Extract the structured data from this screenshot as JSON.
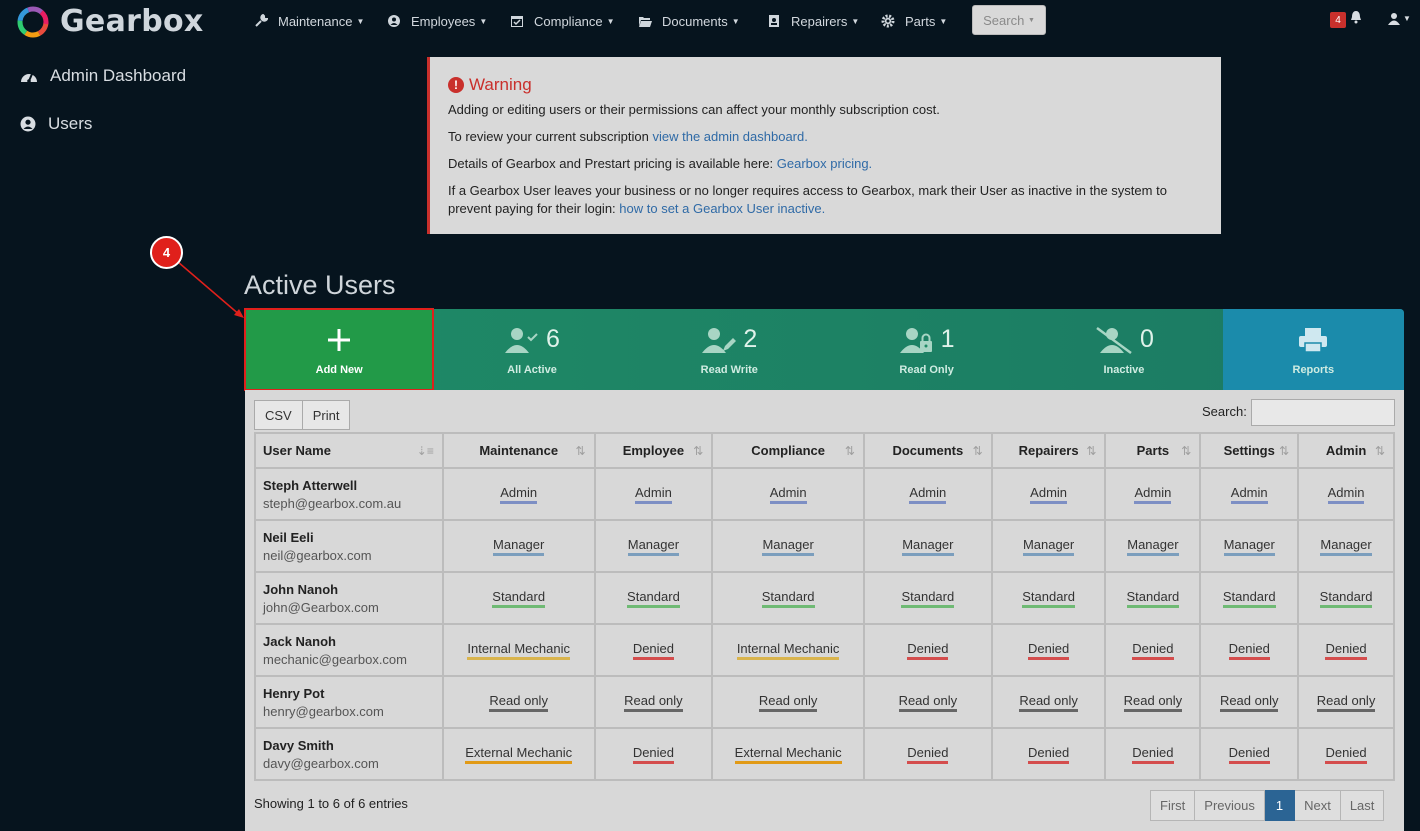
{
  "app": {
    "name": "Gearbox"
  },
  "nav": {
    "items": [
      {
        "label": "Maintenance",
        "icon": "wrench-icon"
      },
      {
        "label": "Employees",
        "icon": "user-circle-icon"
      },
      {
        "label": "Compliance",
        "icon": "calendar-check-icon"
      },
      {
        "label": "Documents",
        "icon": "folder-open-icon"
      },
      {
        "label": "Repairers",
        "icon": "address-book-icon"
      },
      {
        "label": "Parts",
        "icon": "gear-icon"
      }
    ],
    "search_label": "Search",
    "notification_count": "4"
  },
  "sidebar": {
    "items": [
      {
        "label": "Admin Dashboard",
        "icon": "dashboard-gauge-icon"
      },
      {
        "label": "Users",
        "icon": "user-circle-icon"
      }
    ]
  },
  "warning": {
    "title": "Warning",
    "line1": "Adding or editing users or their permissions can affect your monthly subscription cost.",
    "line2_text": "To review your current subscription ",
    "line2_link": "view the admin dashboard.",
    "line3_text": "Details of Gearbox and Prestart pricing is available here: ",
    "line3_link": "Gearbox pricing.",
    "line4_text": "If a Gearbox User leaves your business or no longer requires access to Gearbox, mark their User as inactive in the system to prevent paying for their login: ",
    "line4_link": "how to set a Gearbox User inactive."
  },
  "callout": {
    "number": "4"
  },
  "page_title": "Active Users",
  "tiles": {
    "add_new": "Add New",
    "all_active": {
      "count": "6",
      "label": "All Active"
    },
    "read_write": {
      "count": "2",
      "label": "Read Write"
    },
    "read_only": {
      "count": "1",
      "label": "Read Only"
    },
    "inactive": {
      "count": "0",
      "label": "Inactive"
    },
    "reports": "Reports"
  },
  "table_tools": {
    "csv": "CSV",
    "print": "Print",
    "search_label": "Search:"
  },
  "table": {
    "headers": [
      "User Name",
      "Maintenance",
      "Employee",
      "Compliance",
      "Documents",
      "Repairers",
      "Parts",
      "Settings",
      "Admin"
    ],
    "rows": [
      {
        "name": "Steph Atterwell",
        "email": "steph@gearbox.com.au",
        "perms": [
          "Admin",
          "Admin",
          "Admin",
          "Admin",
          "Admin",
          "Admin",
          "Admin",
          "Admin"
        ],
        "kinds": [
          "admin",
          "admin",
          "admin",
          "admin",
          "admin",
          "admin",
          "admin",
          "admin"
        ]
      },
      {
        "name": "Neil Eeli",
        "email": "neil@gearbox.com",
        "perms": [
          "Manager",
          "Manager",
          "Manager",
          "Manager",
          "Manager",
          "Manager",
          "Manager",
          "Manager"
        ],
        "kinds": [
          "manager",
          "manager",
          "manager",
          "manager",
          "manager",
          "manager",
          "manager",
          "manager"
        ]
      },
      {
        "name": "John Nanoh",
        "email": "john@Gearbox.com",
        "perms": [
          "Standard",
          "Standard",
          "Standard",
          "Standard",
          "Standard",
          "Standard",
          "Standard",
          "Standard"
        ],
        "kinds": [
          "standard",
          "standard",
          "standard",
          "standard",
          "standard",
          "standard",
          "standard",
          "standard"
        ]
      },
      {
        "name": "Jack Nanoh",
        "email": "mechanic@gearbox.com",
        "perms": [
          "Internal Mechanic",
          "Denied",
          "Internal Mechanic",
          "Denied",
          "Denied",
          "Denied",
          "Denied",
          "Denied"
        ],
        "kinds": [
          "internal",
          "denied",
          "internal",
          "denied",
          "denied",
          "denied",
          "denied",
          "denied"
        ]
      },
      {
        "name": "Henry Pot",
        "email": "henry@gearbox.com",
        "perms": [
          "Read only",
          "Read only",
          "Read only",
          "Read only",
          "Read only",
          "Read only",
          "Read only",
          "Read only"
        ],
        "kinds": [
          "readonly",
          "readonly",
          "readonly",
          "readonly",
          "readonly",
          "readonly",
          "readonly",
          "readonly"
        ]
      },
      {
        "name": "Davy Smith",
        "email": "davy@gearbox.com",
        "perms": [
          "External Mechanic",
          "Denied",
          "External Mechanic",
          "Denied",
          "Denied",
          "Denied",
          "Denied",
          "Denied"
        ],
        "kinds": [
          "external",
          "denied",
          "external",
          "denied",
          "denied",
          "denied",
          "denied",
          "denied"
        ]
      }
    ]
  },
  "footer": {
    "info": "Showing 1 to 6 of 6 entries",
    "pager": [
      "First",
      "Previous",
      "1",
      "Next",
      "Last"
    ]
  },
  "colors": {
    "background": "#06141e",
    "add_new_tile": "#229a48",
    "tiles": "#1f8a66",
    "reports_tile": "#1b8bab",
    "warning_accent": "#c9302c",
    "link": "#2f6aa6"
  }
}
